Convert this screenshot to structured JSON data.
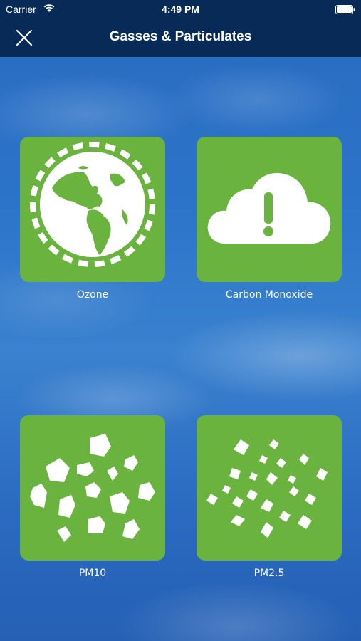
{
  "status_bar": {
    "carrier": "Carrier",
    "time": "4:49 PM",
    "wifi_icon": "wifi-icon",
    "battery_icon": "battery-icon"
  },
  "nav": {
    "title": "Gasses & Particulates",
    "close_icon": "close-icon"
  },
  "tiles": [
    {
      "label": "Ozone",
      "icon": "earth-icon"
    },
    {
      "label": "Carbon Monoxide",
      "icon": "cloud-alert-icon"
    },
    {
      "label": "PM10",
      "icon": "large-particles-icon"
    },
    {
      "label": "PM2.5",
      "icon": "small-particles-icon"
    }
  ],
  "colors": {
    "tile_green": "#6ab33f",
    "nav_background": "#082a57",
    "icon_white": "#ffffff"
  }
}
